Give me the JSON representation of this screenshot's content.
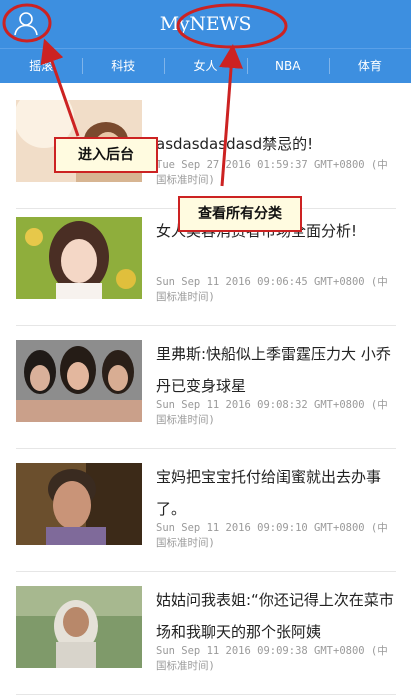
{
  "header": {
    "title": "MyNEWS",
    "avatar_icon": "user-icon"
  },
  "tabs": [
    {
      "label": "摇滚"
    },
    {
      "label": "科技"
    },
    {
      "label": "女人"
    },
    {
      "label": "NBA"
    },
    {
      "label": "体育"
    }
  ],
  "articles": [
    {
      "title": "asdasdasdasd禁忌的!",
      "time_line1": "Tue Sep 27 2016 01:59:37 GMT+0800 (中",
      "time_line2": "国标准时间)"
    },
    {
      "title": "女人美容消费者市场全面分析!",
      "time_line1": "Sun Sep 11 2016 09:06:45 GMT+0800 (中",
      "time_line2": "国标准时间)"
    },
    {
      "title": "里弗斯:快船似上季雷霆压力大 小乔丹已变身球星",
      "time_line1": "Sun Sep 11 2016 09:08:32 GMT+0800 (中",
      "time_line2": "国标准时间)"
    },
    {
      "title": "宝妈把宝宝托付给闺蜜就出去办事了。",
      "time_line1": "Sun Sep 11 2016 09:09:10 GMT+0800 (中",
      "time_line2": "国标准时间)"
    },
    {
      "title": "姑姑问我表姐:“你还记得上次在菜市场和我聊天的那个张阿姨",
      "time_line1": "Sun Sep 11 2016 09:09:38 GMT+0800 (中",
      "time_line2": "国标准时间)"
    }
  ],
  "annotations": {
    "backend_label": "进入后台",
    "categories_label": "查看所有分类"
  },
  "colors": {
    "header": "#3d8fe0",
    "annotation_red": "#cc2222",
    "callout_bg": "#fffbe0"
  }
}
